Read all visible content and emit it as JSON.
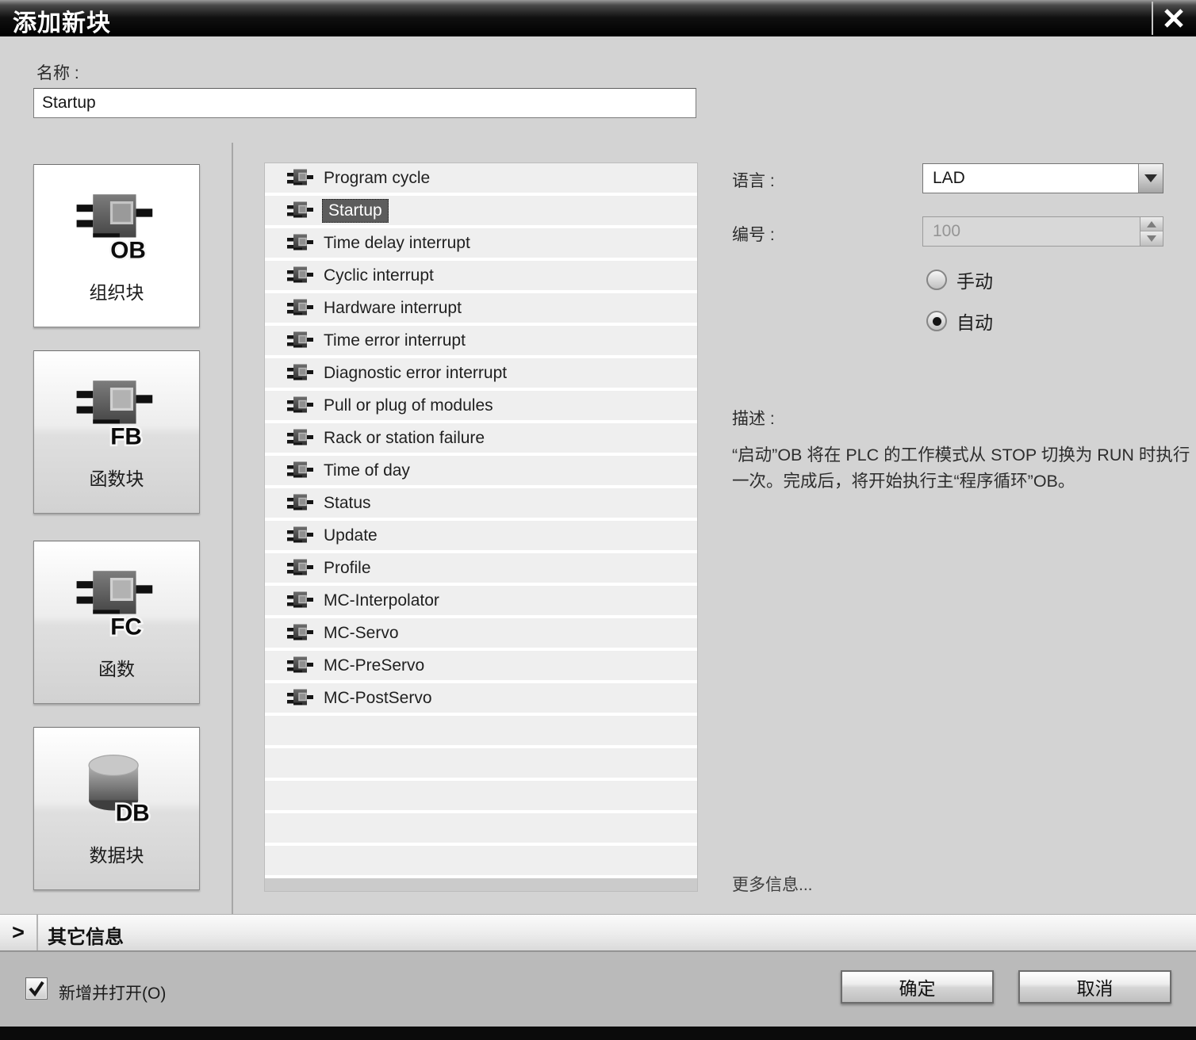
{
  "title_bar": {
    "title": "添加新块"
  },
  "name_field": {
    "label": "名称 :",
    "value": "Startup"
  },
  "block_types": [
    {
      "badge": "OB",
      "label": "组织块",
      "selected": true
    },
    {
      "badge": "FB",
      "label": "函数块",
      "selected": false
    },
    {
      "badge": "FC",
      "label": "函数",
      "selected": false
    },
    {
      "badge": "DB",
      "label": "数据块",
      "selected": false
    }
  ],
  "event_list": {
    "items": [
      "Program cycle",
      "Startup",
      "Time delay interrupt",
      "Cyclic interrupt",
      "Hardware interrupt",
      "Time error interrupt",
      "Diagnostic error interrupt",
      "Pull or plug of modules",
      "Rack or station failure",
      "Time of day",
      "Status",
      "Update",
      "Profile",
      "MC-Interpolator",
      "MC-Servo",
      "MC-PreServo",
      "MC-PostServo"
    ],
    "selected_item": "Startup",
    "selected_index": 1
  },
  "properties": {
    "language_label": "语言 :",
    "language_value": "LAD",
    "number_label": "编号 :",
    "number_value": "100",
    "manual_label": "手动",
    "auto_label": "自动",
    "selected_mode": "自动",
    "description_label": "描述 :",
    "description_text": "“启动”OB 将在 PLC 的工作模式从 STOP 切换为 RUN 时执行一次。完成后，将开始执行主“程序循环”OB。",
    "more_info_label": "更多信息..."
  },
  "expander": {
    "label": "其它信息"
  },
  "footer": {
    "checkbox_label": "新增并打开(O)",
    "checkbox_checked": true,
    "ok_label": "确定",
    "cancel_label": "取消"
  },
  "colors": {
    "titlebar": "#000000",
    "dialog_bg": "#d3d3d3",
    "row_bg": "#efefef",
    "selection_bg": "#5c5c5c",
    "footer_bg": "#bababa"
  }
}
